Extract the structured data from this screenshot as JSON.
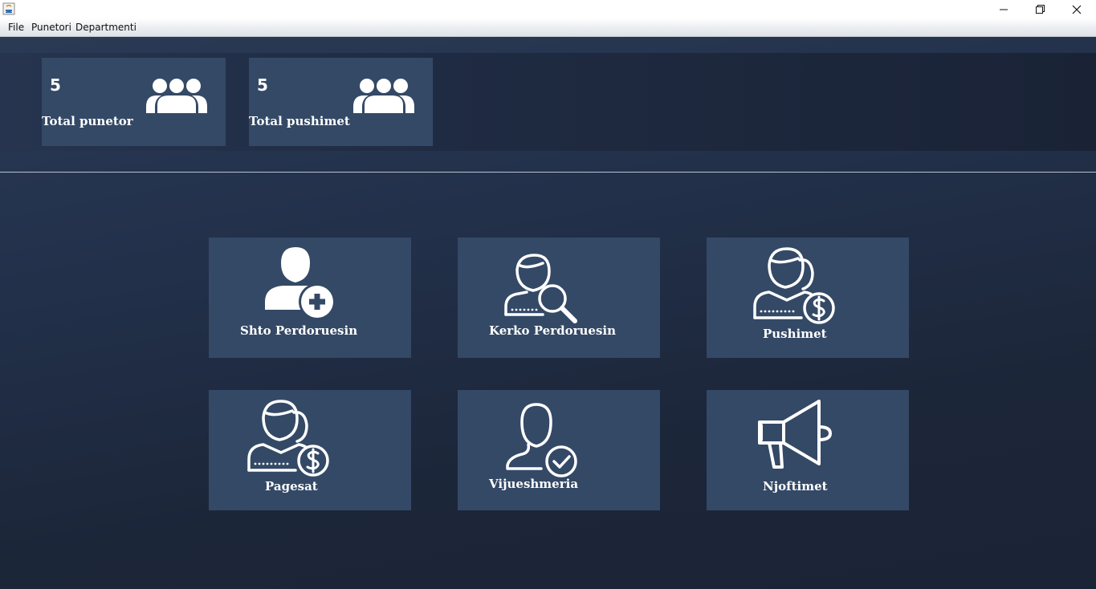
{
  "menu": {
    "items": [
      "File",
      "Punetori",
      "Departmenti"
    ]
  },
  "stats": [
    {
      "value": "5",
      "label": "Total punetor"
    },
    {
      "value": "5",
      "label": "Total pushimet"
    }
  ],
  "tiles": [
    {
      "label": "Shto Perdoruesin",
      "icon": "user-add-icon"
    },
    {
      "label": "Kerko Perdoruesin",
      "icon": "user-search-icon"
    },
    {
      "label": "Pushimet",
      "icon": "users-dollar-icon"
    },
    {
      "label": "Pagesat",
      "icon": "users-dollar-icon"
    },
    {
      "label": "Vijueshmeria",
      "icon": "user-check-icon"
    },
    {
      "label": "Njoftimet",
      "icon": "megaphone-icon"
    }
  ],
  "colors": {
    "background": "#1c2639",
    "tile": "#344966",
    "text": "#ffffff"
  }
}
